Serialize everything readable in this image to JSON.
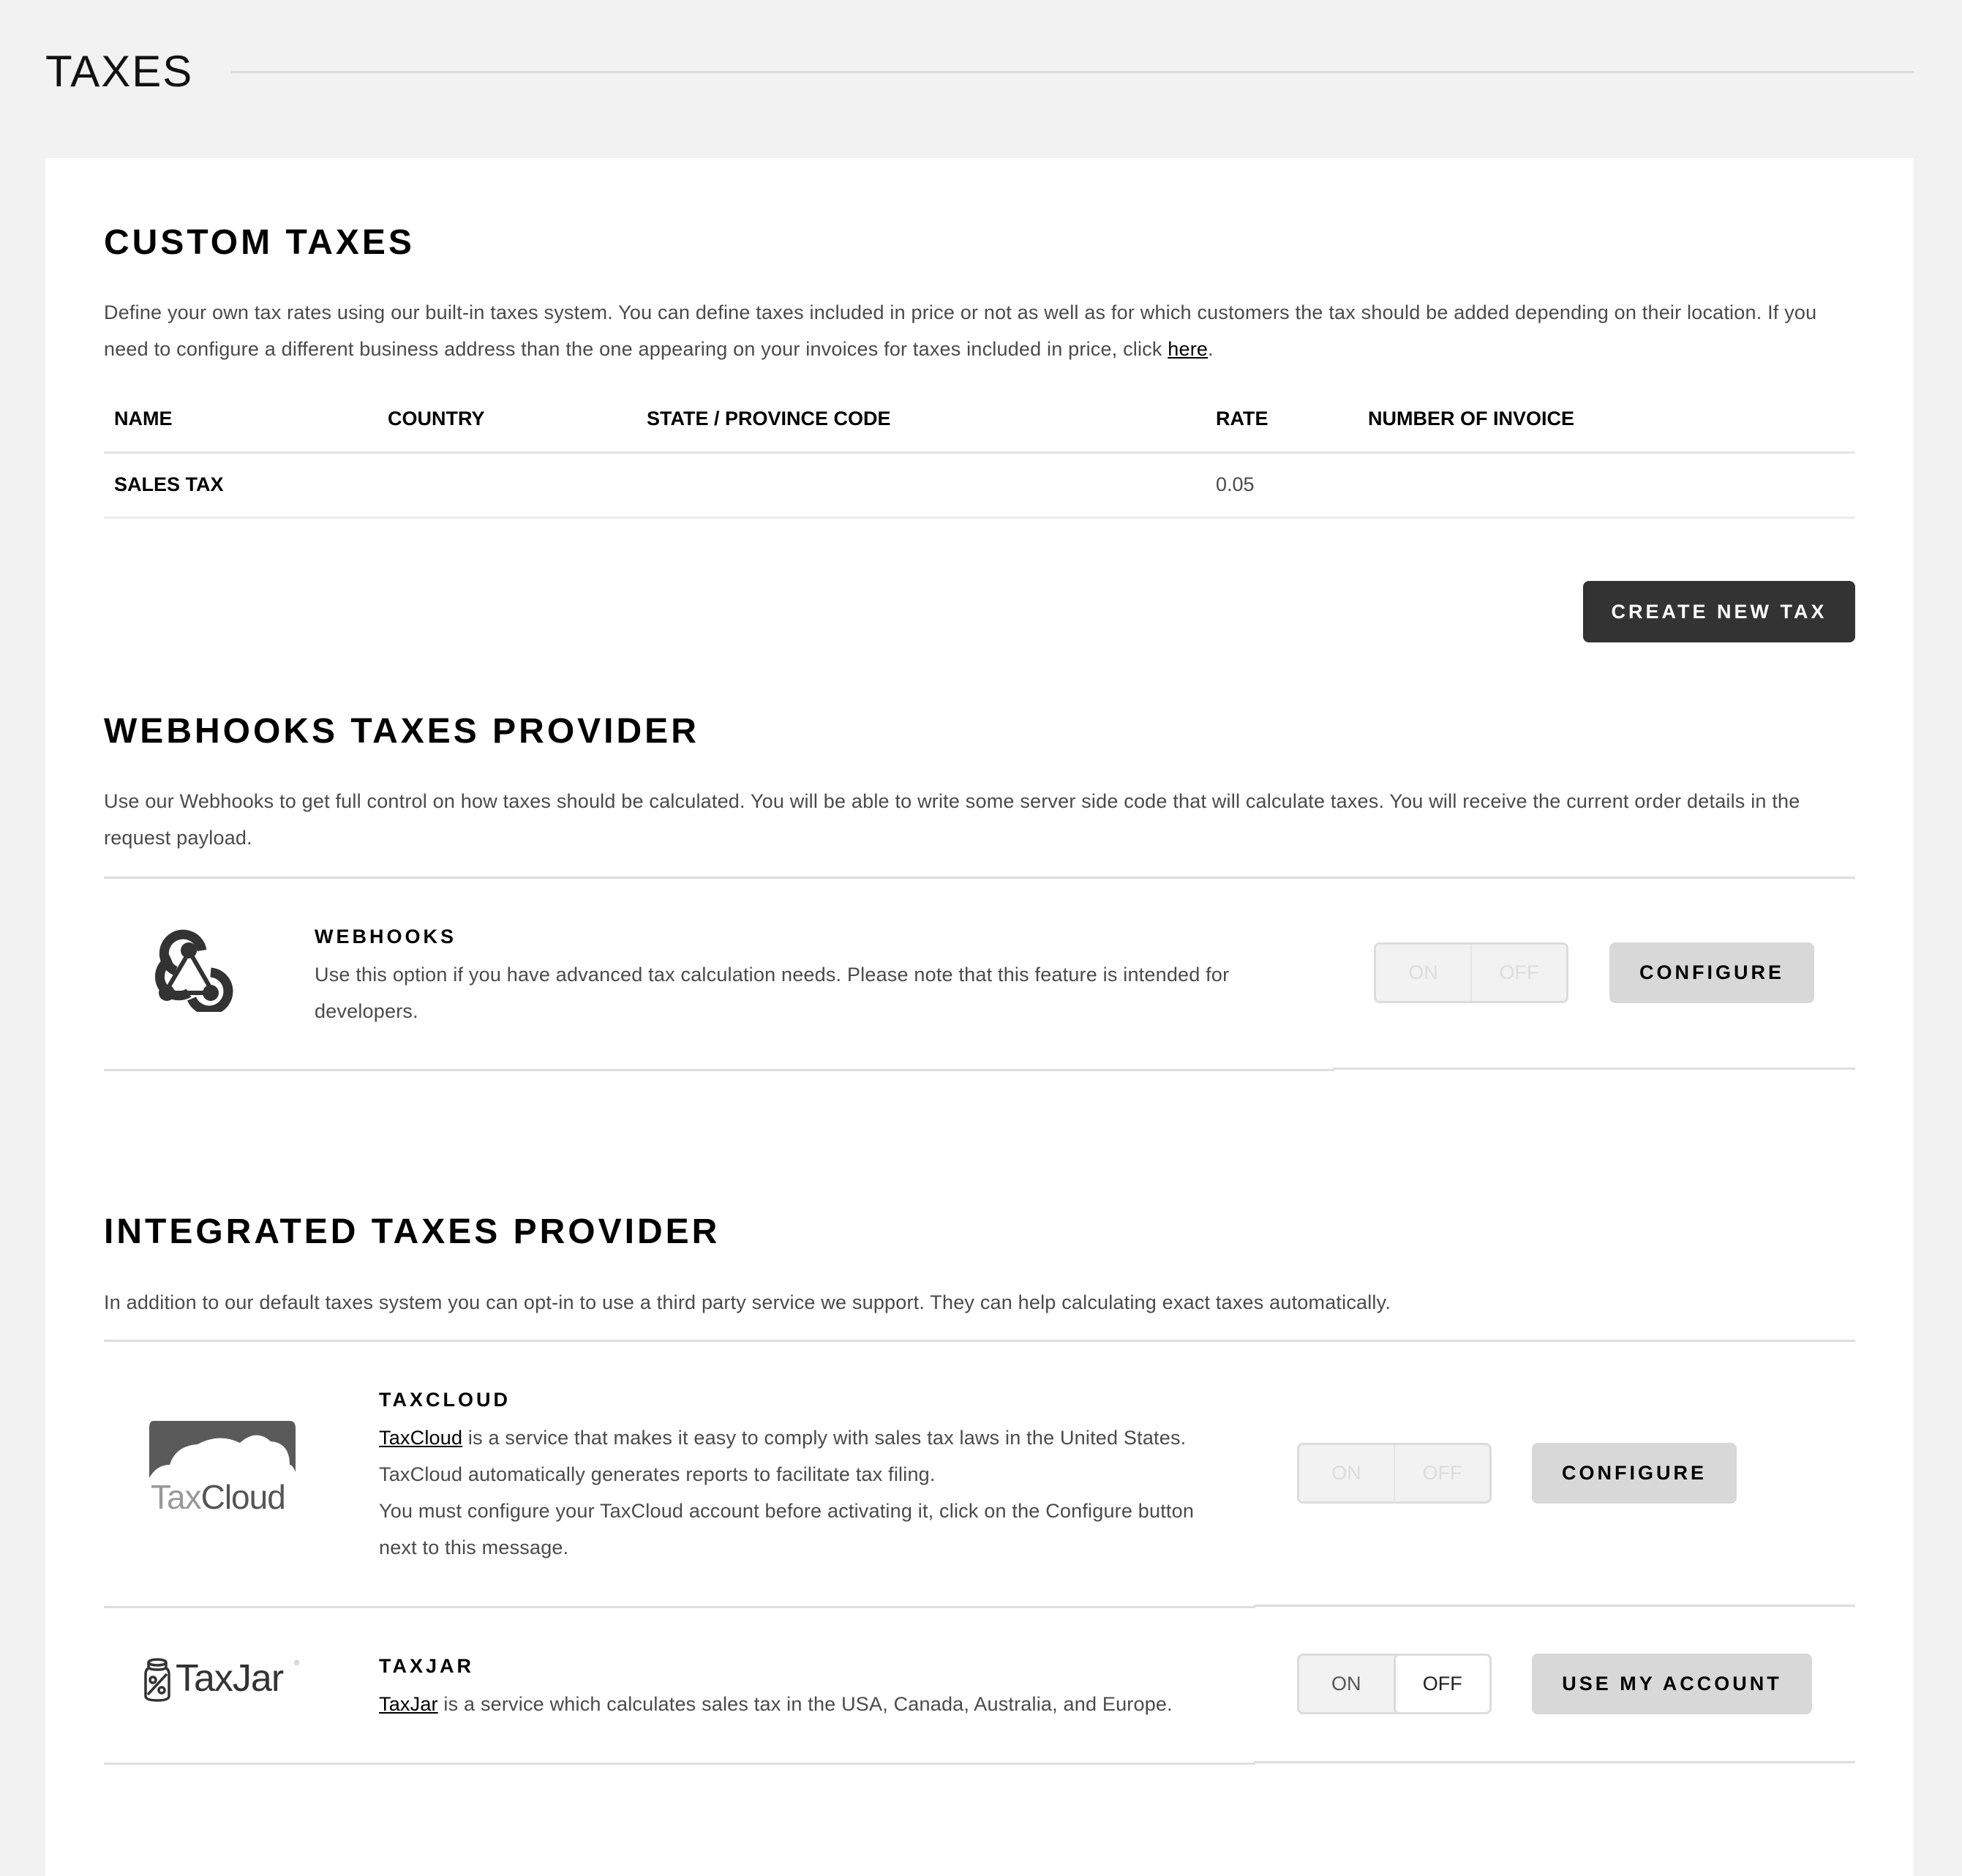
{
  "page": {
    "title": "TAXES"
  },
  "custom_taxes": {
    "heading": "CUSTOM TAXES",
    "description_line1": "Define your own tax rates using our built-in taxes system. You can define taxes included in price or not as well as for which customers the tax should be added depending on their location. If you",
    "description_line2_prefix": "need to configure a different business address than the one appearing on your invoices for taxes included in price, click ",
    "description_link": "here",
    "description_suffix": ".",
    "table": {
      "columns": [
        "NAME",
        "COUNTRY",
        "STATE / PROVINCE CODE",
        "RATE",
        "NUMBER OF INVOICE"
      ],
      "rows": [
        {
          "name": "SALES TAX",
          "country": "",
          "state": "",
          "rate": "0.05",
          "invoices": ""
        }
      ]
    },
    "create_button": "CREATE NEW TAX"
  },
  "webhooks_provider": {
    "heading": "WEBHOOKS TAXES PROVIDER",
    "description_line1": "Use our Webhooks to get full control on how taxes should be calculated. You will be able to write some server side code that will calculate taxes. You will receive the current order details in the",
    "description_line2": "request payload.",
    "item": {
      "icon": "webhook-icon",
      "title": "WEBHOOKS",
      "description_line1": "Use this option if you have advanced tax calculation needs. Please note that this feature is intended for",
      "description_line2": "developers.",
      "toggle": {
        "on_label": "ON",
        "off_label": "OFF",
        "state": "disabled"
      },
      "button": "CONFIGURE"
    }
  },
  "integrated_provider": {
    "heading": "INTEGRATED TAXES PROVIDER",
    "description": "In addition to our default taxes system you can opt-in to use a third party service we support. They can help calculating exact taxes automatically.",
    "items": [
      {
        "logo": "taxcloud-logo",
        "logo_text_light": "Tax",
        "logo_text_dark": "Cloud",
        "title": "TAXCLOUD",
        "link": "TaxCloud",
        "line1_suffix": " is a service that makes it easy to comply with sales tax laws in the United States.",
        "line2": "TaxCloud automatically generates reports to facilitate tax filing.",
        "line3": "You must configure your TaxCloud account before activating it, click on the Configure button",
        "line4": "next to this message.",
        "toggle": {
          "on_label": "ON",
          "off_label": "OFF",
          "state": "disabled"
        },
        "button": "CONFIGURE"
      },
      {
        "logo": "taxjar-logo",
        "logo_text": "TaxJar",
        "title": "TAXJAR",
        "link": "TaxJar",
        "line1_suffix": " is a service which calculates sales tax in the USA, Canada, Australia, and Europe.",
        "toggle": {
          "on_label": "ON",
          "off_label": "OFF",
          "state": "off"
        },
        "button": "USE MY ACCOUNT"
      }
    ]
  },
  "colors": {
    "background": "#f2f2f2",
    "card": "#ffffff",
    "primary_button": "#333333",
    "secondary_button": "#d8d8d8",
    "text_muted": "#4a4a4a",
    "divider": "#dedede"
  }
}
